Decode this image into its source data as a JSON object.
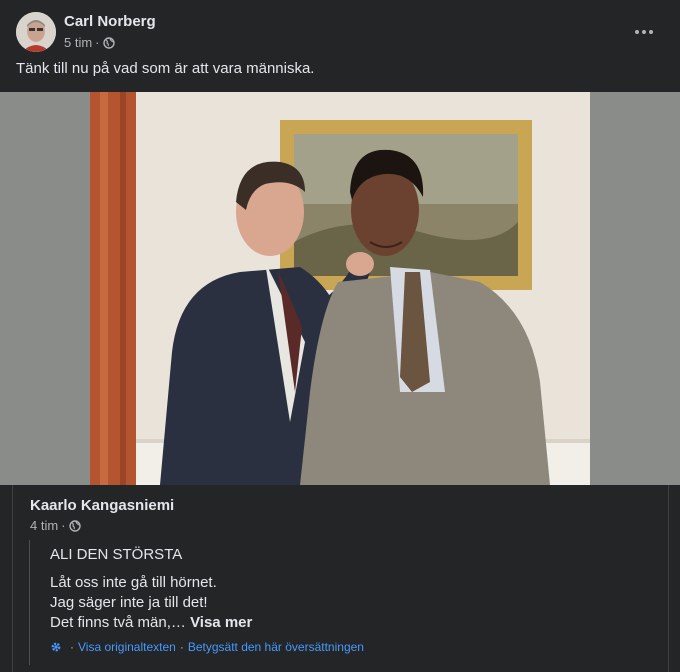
{
  "post": {
    "author": "Carl Norberg",
    "time": "5 tim",
    "audience_icon": "globe-icon",
    "text": "Tänk till nu på vad som är att vara människa."
  },
  "shared": {
    "author": "Kaarlo Kangasniemi",
    "time": "4 tim",
    "audience_icon": "globe-icon",
    "title": "ALI DEN STÖRSTA",
    "lines": [
      "Låt oss inte gå till hörnet.",
      "Jag säger inte ja till det!",
      "Det finns två män,…"
    ],
    "see_more": "Visa mer",
    "translation_icon": "gear-icon",
    "show_original": "Visa originaltexten",
    "rate_translation": "Betygsätt den här översättningen"
  },
  "colors": {
    "background": "#242526",
    "text": "#e4e6eb",
    "secondary": "#b0b3b8",
    "link": "#4599ff"
  }
}
